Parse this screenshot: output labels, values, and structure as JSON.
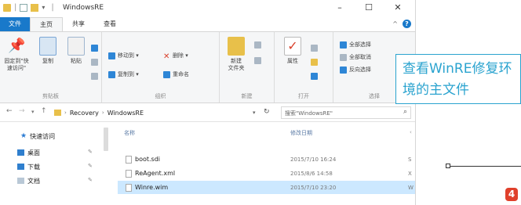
{
  "window": {
    "title": "WindowsRE",
    "controls": {
      "minimize": "–",
      "maximize": "☐",
      "close": "✕"
    }
  },
  "tabs": [
    {
      "label": "文件",
      "active": false
    },
    {
      "label": "主页",
      "active": true
    },
    {
      "label": "共享",
      "active": false
    },
    {
      "label": "查看",
      "active": false
    }
  ],
  "ribbon": {
    "clipboard": {
      "label": "剪贴板",
      "pin_label": "固定到\"快速访问\"",
      "copy_label": "复制",
      "paste_label": "粘贴"
    },
    "organize": {
      "label": "组织",
      "move_to": "移动到 ▾",
      "delete": "删除 ▾",
      "copy_to": "复制到 ▾",
      "rename": "重命名"
    },
    "new": {
      "label": "新建",
      "new_folder": "新建\n文件夹"
    },
    "open": {
      "label": "打开",
      "properties": "属性"
    },
    "select": {
      "label": "选择",
      "select_all": "全部选择",
      "select_none": "全部取消",
      "invert": "反向选择"
    }
  },
  "address": {
    "crumbs": [
      "Recovery",
      "WindowsRE"
    ],
    "search_placeholder": "搜索\"WindowsRE\""
  },
  "nav": {
    "items": [
      {
        "label": "快速访问",
        "icon": "star-icon"
      },
      {
        "label": "桌面",
        "icon": "desktop-icon"
      },
      {
        "label": "下载",
        "icon": "download-icon"
      },
      {
        "label": "文档",
        "icon": "documents-icon"
      }
    ]
  },
  "columns": {
    "name": "名称",
    "date": "修改日期"
  },
  "files": [
    {
      "name": "boot.sdi",
      "date": "2015/7/10 16:24",
      "type": "S"
    },
    {
      "name": "ReAgent.xml",
      "date": "2015/8/6 14:58",
      "type": "X"
    },
    {
      "name": "Winre.wim",
      "date": "2015/7/10 23:20",
      "type": "W",
      "selected": true
    }
  ],
  "callout": {
    "text": "查看WinRE修复环境的主文件"
  },
  "step_badge": "4",
  "colors": {
    "accent": "#1979ca",
    "callout": "#2aa3cf",
    "badge": "#e0402b",
    "selection": "#cce8ff"
  }
}
